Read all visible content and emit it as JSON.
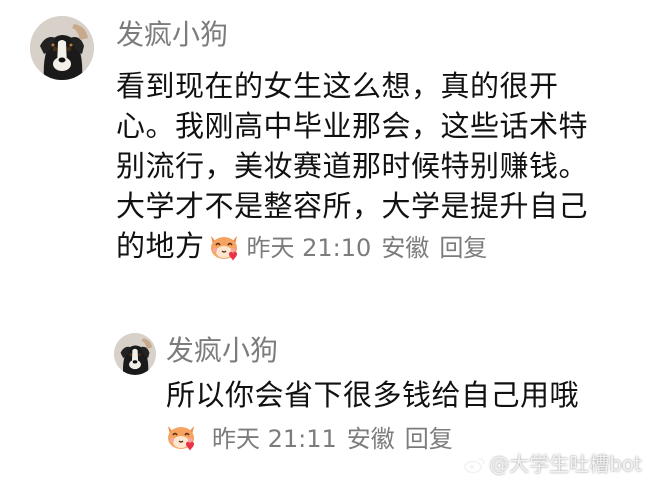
{
  "comment": {
    "username": "发疯小狗",
    "lines": [
      "看到现在的女生这么想，真的很开",
      "心。我刚高中毕业那会，这些话术特",
      "别流行，美妆赛道那时候特别赚钱。",
      "大学才不是整容所，大学是提升自己",
      "的地方"
    ],
    "emoji": "cat-heart-emoji",
    "time": "昨天 21:10",
    "location": "安徽",
    "reply_label": "回复"
  },
  "reply": {
    "username": "发疯小狗",
    "text": "所以你会省下很多钱给自己用哦",
    "emoji": "cat-heart-emoji",
    "time": "昨天 21:11",
    "location": "安徽",
    "reply_label": "回复"
  },
  "watermark": {
    "text": "@大学生吐槽bot"
  },
  "colors": {
    "text": "#111111",
    "meta": "#7c7c7c",
    "background": "#ffffff",
    "emoji_orange": "#f0894a",
    "emoji_heart": "#e8334a"
  }
}
